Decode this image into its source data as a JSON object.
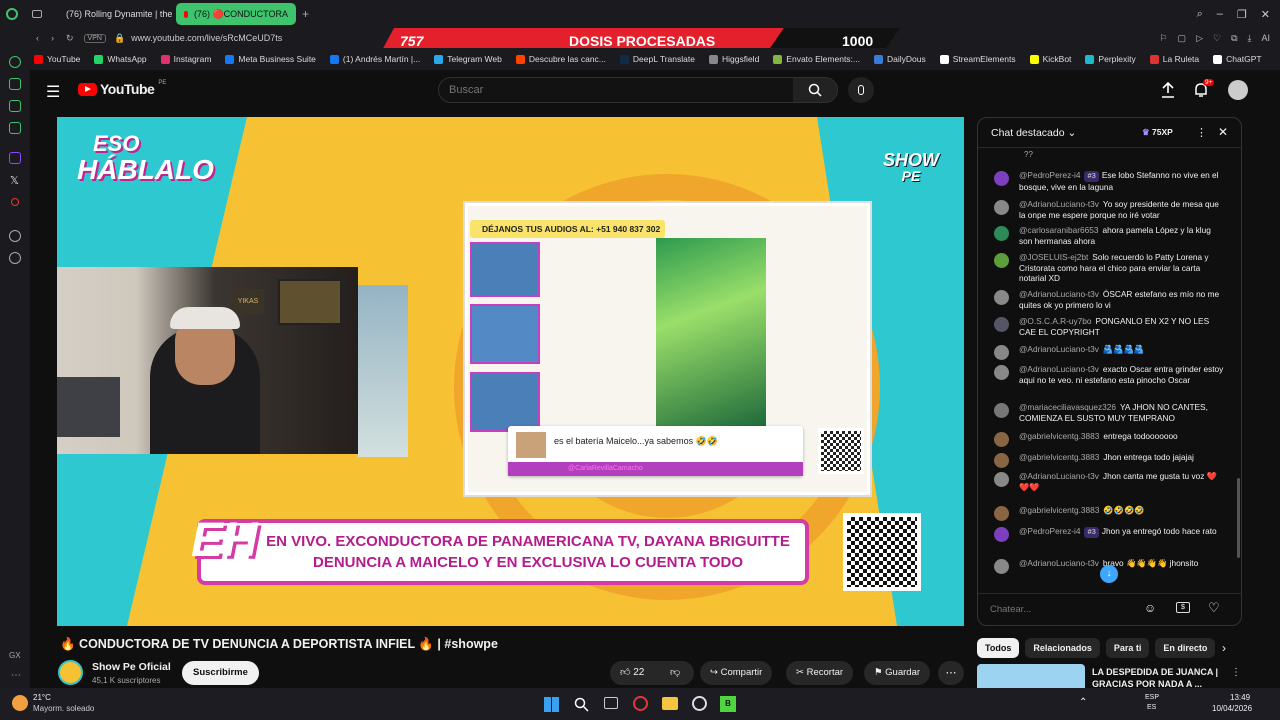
{
  "browser": {
    "tabs": [
      {
        "label": "(76) Rolling Dynamite | the",
        "active": false
      },
      {
        "label": "(76) 🔴CONDUCTORA",
        "active": true
      }
    ],
    "new_tab": "+",
    "vpn": "VPN",
    "url": "www.youtube.com/live/sRcMCeUD7ts",
    "ai_label": "AI",
    "bookmarks": [
      "YouTube",
      "WhatsApp",
      "Instagram",
      "Meta Business Suite",
      "(1) Andrés Martín |...",
      "Telegram Web",
      "Descubre las canc...",
      "DeepL Translate",
      "Higgsfield",
      "Envato Elements:...",
      "DailyDous",
      "StreamElements",
      "KickBot",
      "Perplexity",
      "La Ruleta",
      "ChatGPT"
    ]
  },
  "overlay": {
    "left_number": "757",
    "label": "DOSIS PROCESADAS",
    "right_number": "1000"
  },
  "youtube": {
    "logo": "YouTube",
    "region": "PE",
    "search_placeholder": "Buscar",
    "notif_count": "9+"
  },
  "video": {
    "show_title_line1": "ESO",
    "show_title_line2": "HÁBLALO",
    "corner_logo_line1": "SHOW",
    "corner_logo_line2": "PE",
    "audio_banner": "DÉJANOS TUS AUDIOS AL: +51 940 837 302",
    "comment_text": "es el batería Maicelo...ya sabemos 🤣🤣",
    "comment_user": "@CarlaRevillaCamacho",
    "lower_badge": "EH",
    "lower_third": "EN VIVO. EXCONDUCTORA DE PANAMERICANA TV, DAYANA BRIGUITTE DENUNCIA A MAICELO  Y EN EXCLUSIVA LO CUENTA TODO",
    "cam_sign": "YIKAS"
  },
  "chat": {
    "title": "Chat destacado",
    "xp": "75XP",
    "partial_top": "??",
    "messages": [
      {
        "author": "@PedroPerez-i4",
        "badge": "#3",
        "text": "Ese lobo Stefanno no vive en el bosque, vive en la laguna",
        "color": "#7b3fbf"
      },
      {
        "author": "@AdrianoLuciano-t3v",
        "badge": "",
        "text": "Yo soy presidente de mesa que la onpe me espere porque no iré votar",
        "color": "#888"
      },
      {
        "author": "@carlosaranibar6653",
        "badge": "",
        "text": "ahora pamela López y la klug son hermanas ahora",
        "color": "#2e8b57"
      },
      {
        "author": "@JOSELUIS-ej2bt",
        "badge": "",
        "text": "Solo recuerdo lo Patty Lorena y Cristorata como hara el chico para enviar la carta notarial XD",
        "color": "#5c9e3a"
      },
      {
        "author": "@AdrianoLuciano-t3v",
        "badge": "",
        "text": "ÓSCAR estefano es mío no me quites ok yo primero lo vi",
        "color": "#888"
      },
      {
        "author": "@O.S.C.A.R-uy7bo",
        "badge": "",
        "text": "PONGANLO EN X2 Y NO LES CAE EL COPYRIGHT",
        "color": "#556"
      },
      {
        "author": "@AdrianoLuciano-t3v",
        "badge": "",
        "text": "🫂🫂🫂🫂",
        "color": "#888"
      },
      {
        "author": "@AdrianoLuciano-t3v",
        "badge": "",
        "text": "exacto Oscar entra grinder estoy aqui no te veo. ni estefano esta pinocho Oscar",
        "color": "#888"
      },
      {
        "author": "@mariaceciliavasquez326",
        "badge": "",
        "text": "YA JHON NO CANTES, COMIENZA EL SUSTO MUY TEMPRANO",
        "color": "#777"
      },
      {
        "author": "@gabrielvicentg.3883",
        "badge": "",
        "text": "entrega todooooooo",
        "color": "#864"
      },
      {
        "author": "@gabrielvicentg.3883",
        "badge": "",
        "text": "Jhon entrega todo jajajaj",
        "color": "#864"
      },
      {
        "author": "@AdrianoLuciano-t3v",
        "badge": "",
        "text": "Jhon canta me gusta tu voz ❤️❤️❤️",
        "color": "#888"
      },
      {
        "author": "@gabrielvicentg.3883",
        "badge": "",
        "text": "🤣🤣🤣🤣",
        "color": "#864"
      },
      {
        "author": "@PedroPerez-i4",
        "badge": "#3",
        "text": "Jhon ya entregó todo hace rato",
        "color": "#7b3fbf"
      },
      {
        "author": "@AdrianoLuciano-t3v",
        "badge": "",
        "text": "bravo 👋👋👋👋 jhonsito",
        "color": "#888"
      }
    ],
    "input_placeholder": "Chatear..."
  },
  "below": {
    "title": "🔥 CONDUCTORA DE TV DENUNCIA A DEPORTISTA INFIEL 🔥 | #showpe",
    "channel_name": "Show Pe Oficial",
    "subs": "45,1 K suscriptores",
    "subscribe": "Suscribirme",
    "likes": "22",
    "share": "Compartir",
    "clip": "Recortar",
    "save": "Guardar"
  },
  "filters": [
    "Todos",
    "Relacionados",
    "Para ti",
    "En directo"
  ],
  "rec": {
    "title": "LA DESPEDIDA DE JUANCA | GRACIAS POR NADA A ..."
  },
  "taskbar": {
    "temp": "21°C",
    "weather": "Mayorm. soleado",
    "lang1": "ESP",
    "lang2": "ES",
    "time": "13:49",
    "date": "10/04/2026"
  }
}
